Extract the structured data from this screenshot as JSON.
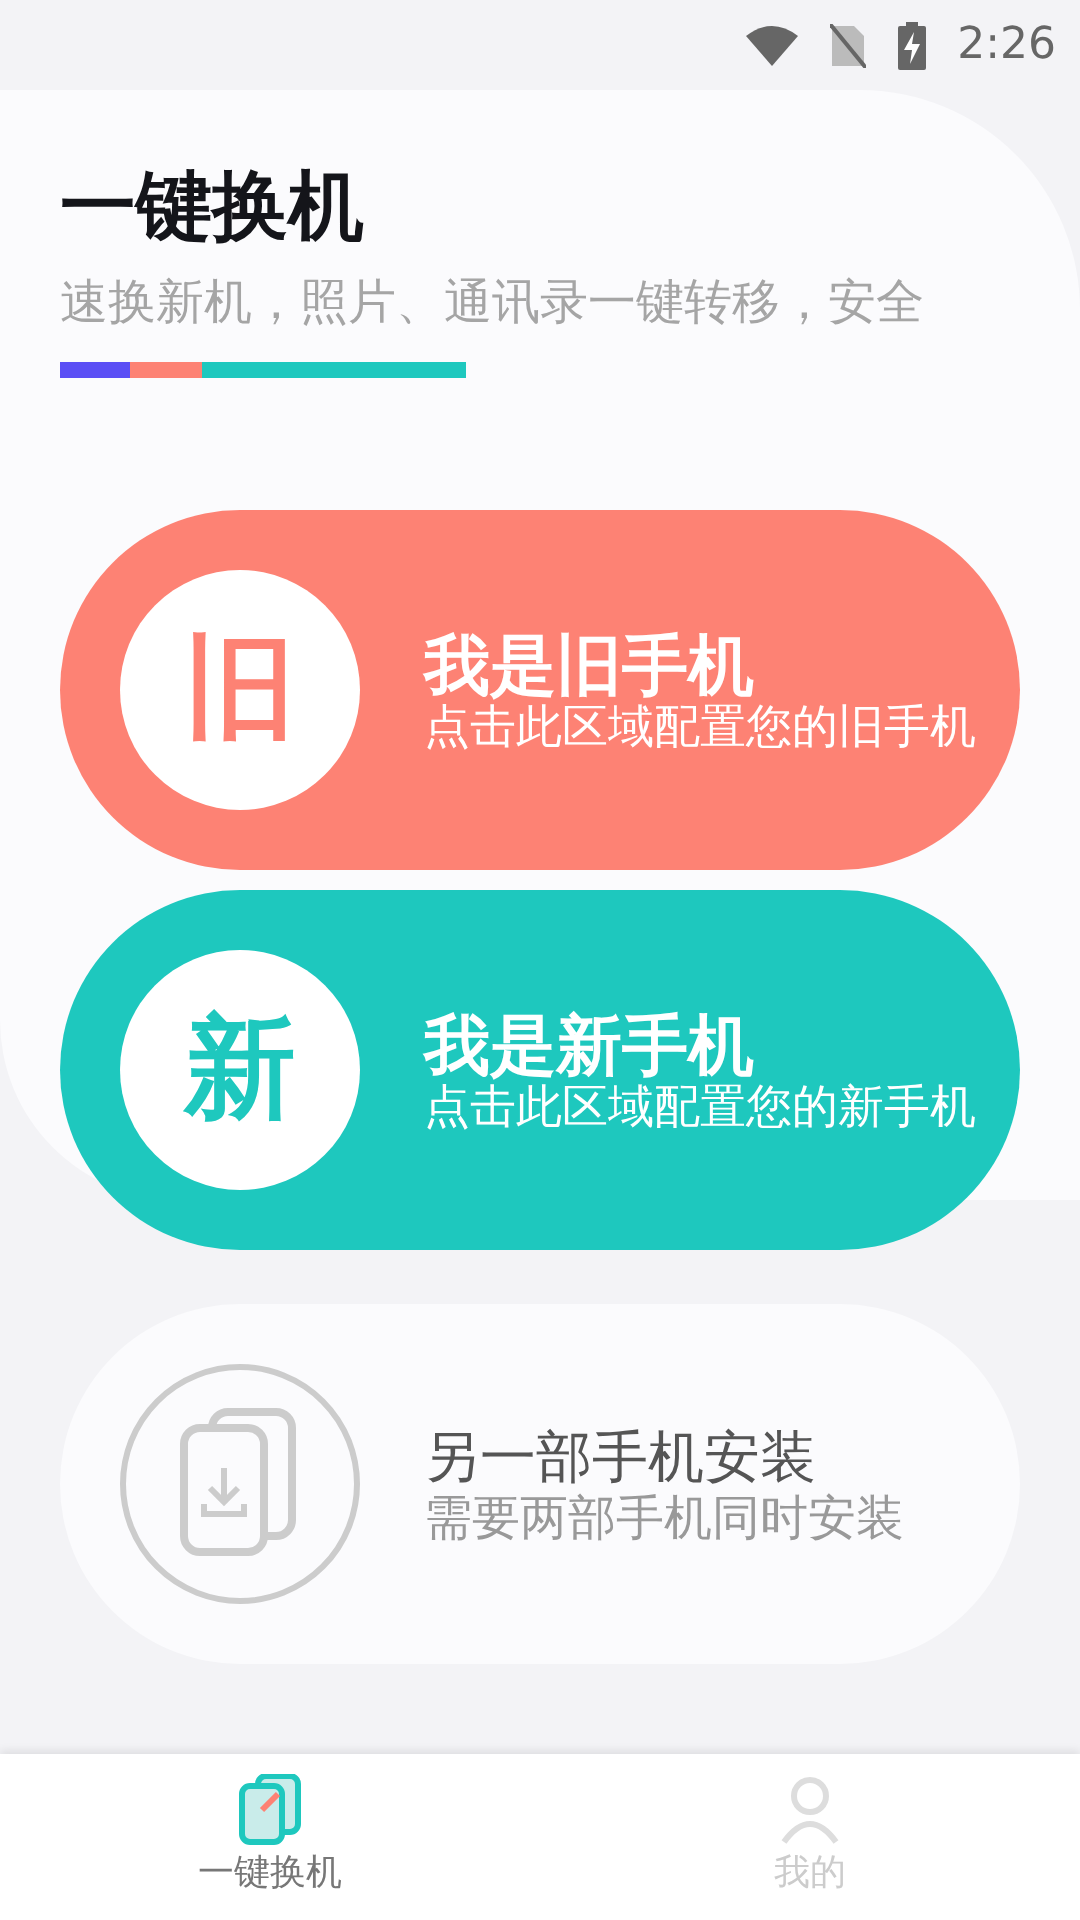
{
  "status_bar": {
    "time": "2:26"
  },
  "header": {
    "title": "一键换机",
    "subtitle": "速换新机，照片、通讯录一键转移，安全",
    "accent_bar": [
      {
        "color": "#5b4ef5"
      },
      {
        "color": "#fd8274"
      },
      {
        "color": "#1ec8be"
      }
    ]
  },
  "options": [
    {
      "kind": "old",
      "badge": "旧",
      "title": "我是旧手机",
      "subtitle": "点击此区域配置您的旧手机",
      "color": "#fd8274"
    },
    {
      "kind": "new",
      "badge": "新",
      "title": "我是新手机",
      "subtitle": "点击此区域配置您的新手机",
      "color": "#1ec8be"
    },
    {
      "kind": "other",
      "title": "另一部手机安装",
      "subtitle": "需要两部手机同时安装"
    }
  ],
  "bottom_nav": [
    {
      "label": "一键换机",
      "selected": true
    },
    {
      "label": "我的",
      "selected": false
    }
  ]
}
